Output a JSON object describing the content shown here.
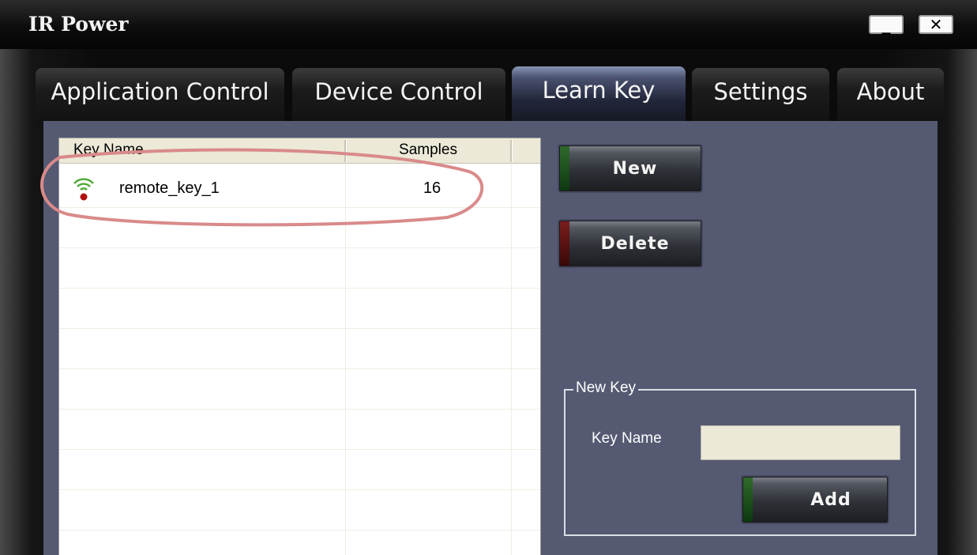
{
  "window": {
    "title": "IR Power",
    "minimize_label": "_",
    "close_label": "✕"
  },
  "tabs": [
    {
      "label": "Application Control",
      "active": false
    },
    {
      "label": "Device Control",
      "active": false
    },
    {
      "label": "Learn Key",
      "active": true
    },
    {
      "label": "Settings",
      "active": false
    },
    {
      "label": "About",
      "active": false
    }
  ],
  "keys_table": {
    "columns": [
      "Key Name",
      "Samples"
    ],
    "rows": [
      {
        "name": "remote_key_1",
        "samples": "16",
        "icon": "ir-signal-icon"
      }
    ]
  },
  "actions": {
    "new_label": "New",
    "delete_label": "Delete"
  },
  "new_key_group": {
    "legend": "New Key",
    "key_name_label": "Key Name",
    "key_name_value": "",
    "add_label": "Add"
  },
  "colors": {
    "panel": "#555a72",
    "accent_green": "#2f6a2b",
    "accent_red": "#7a1d1d",
    "annotation": "#d98a8a"
  }
}
